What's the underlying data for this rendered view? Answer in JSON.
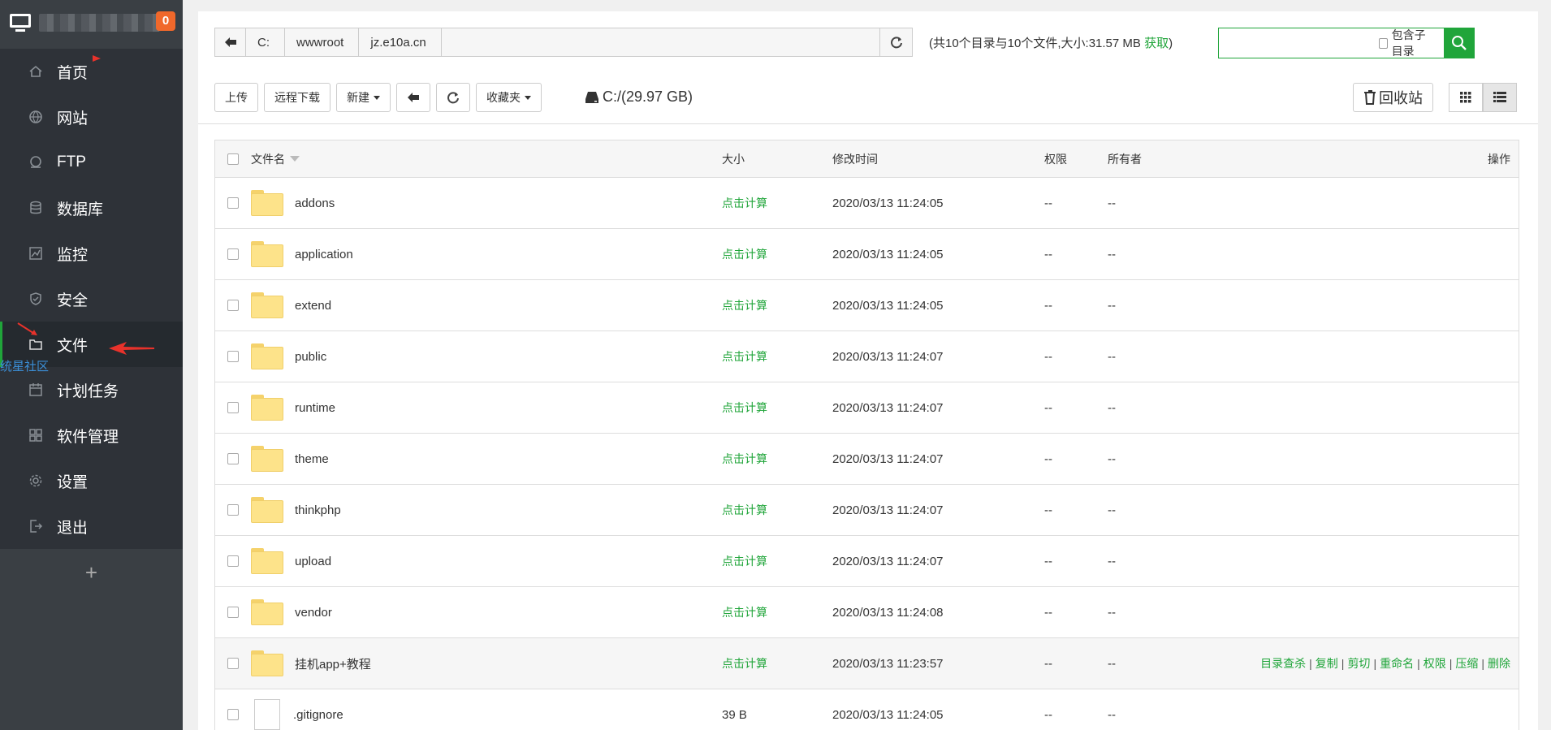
{
  "sidebar": {
    "badge": "0",
    "items": [
      {
        "label": "首页",
        "icon": "home-icon"
      },
      {
        "label": "网站",
        "icon": "globe-icon"
      },
      {
        "label": "FTP",
        "icon": "ftp-icon"
      },
      {
        "label": "数据库",
        "icon": "database-icon"
      },
      {
        "label": "监控",
        "icon": "monitor-chart-icon"
      },
      {
        "label": "安全",
        "icon": "shield-icon"
      },
      {
        "label": "文件",
        "icon": "folder-icon"
      },
      {
        "label": "计划任务",
        "icon": "calendar-icon"
      },
      {
        "label": "软件管理",
        "icon": "grid-icon"
      },
      {
        "label": "设置",
        "icon": "gear-icon"
      },
      {
        "label": "退出",
        "icon": "logout-icon"
      }
    ],
    "add_label": "+",
    "watermark": "统星社区"
  },
  "path": {
    "crumbs": [
      "C:",
      "wwwroot",
      "jz.e10a.cn"
    ]
  },
  "dir_info": {
    "text": "(共10个目录与10个文件,大小:31.57 MB ",
    "fetch": "获取",
    "close": ")"
  },
  "search": {
    "value": "",
    "include_sub": "包含子目录"
  },
  "toolbar": {
    "upload": "上传",
    "remote_download": "远程下载",
    "new": "新建",
    "favorites": "收藏夹",
    "disk": "C:/(29.97 GB)",
    "recycle": "回收站"
  },
  "table": {
    "headers": {
      "name": "文件名",
      "size": "大小",
      "mtime": "修改时间",
      "perm": "权限",
      "owner": "所有者",
      "ops": "操作"
    },
    "rows": [
      {
        "name": "addons",
        "type": "folder",
        "size": "点击计算",
        "mtime": "2020/03/13 11:24:05",
        "perm": "--",
        "owner": "--"
      },
      {
        "name": "application",
        "type": "folder",
        "size": "点击计算",
        "mtime": "2020/03/13 11:24:05",
        "perm": "--",
        "owner": "--"
      },
      {
        "name": "extend",
        "type": "folder",
        "size": "点击计算",
        "mtime": "2020/03/13 11:24:05",
        "perm": "--",
        "owner": "--"
      },
      {
        "name": "public",
        "type": "folder",
        "size": "点击计算",
        "mtime": "2020/03/13 11:24:07",
        "perm": "--",
        "owner": "--"
      },
      {
        "name": "runtime",
        "type": "folder",
        "size": "点击计算",
        "mtime": "2020/03/13 11:24:07",
        "perm": "--",
        "owner": "--"
      },
      {
        "name": "theme",
        "type": "folder",
        "size": "点击计算",
        "mtime": "2020/03/13 11:24:07",
        "perm": "--",
        "owner": "--"
      },
      {
        "name": "thinkphp",
        "type": "folder",
        "size": "点击计算",
        "mtime": "2020/03/13 11:24:07",
        "perm": "--",
        "owner": "--"
      },
      {
        "name": "upload",
        "type": "folder",
        "size": "点击计算",
        "mtime": "2020/03/13 11:24:07",
        "perm": "--",
        "owner": "--"
      },
      {
        "name": "vendor",
        "type": "folder",
        "size": "点击计算",
        "mtime": "2020/03/13 11:24:08",
        "perm": "--",
        "owner": "--"
      },
      {
        "name": "挂机app+教程",
        "type": "folder",
        "size": "点击计算",
        "mtime": "2020/03/13 11:23:57",
        "perm": "--",
        "owner": "--",
        "highlight": true
      },
      {
        "name": ".gitignore",
        "type": "file",
        "size": "39 B",
        "mtime": "2020/03/13 11:24:05",
        "perm": "--",
        "owner": "--"
      }
    ],
    "row_ops": [
      "目录查杀",
      "复制",
      "剪切",
      "重命名",
      "权限",
      "压缩",
      "删除"
    ]
  },
  "colors": {
    "accent": "#20a53a",
    "sidebar_bg": "#3a3f44",
    "badge": "#f0682b"
  }
}
